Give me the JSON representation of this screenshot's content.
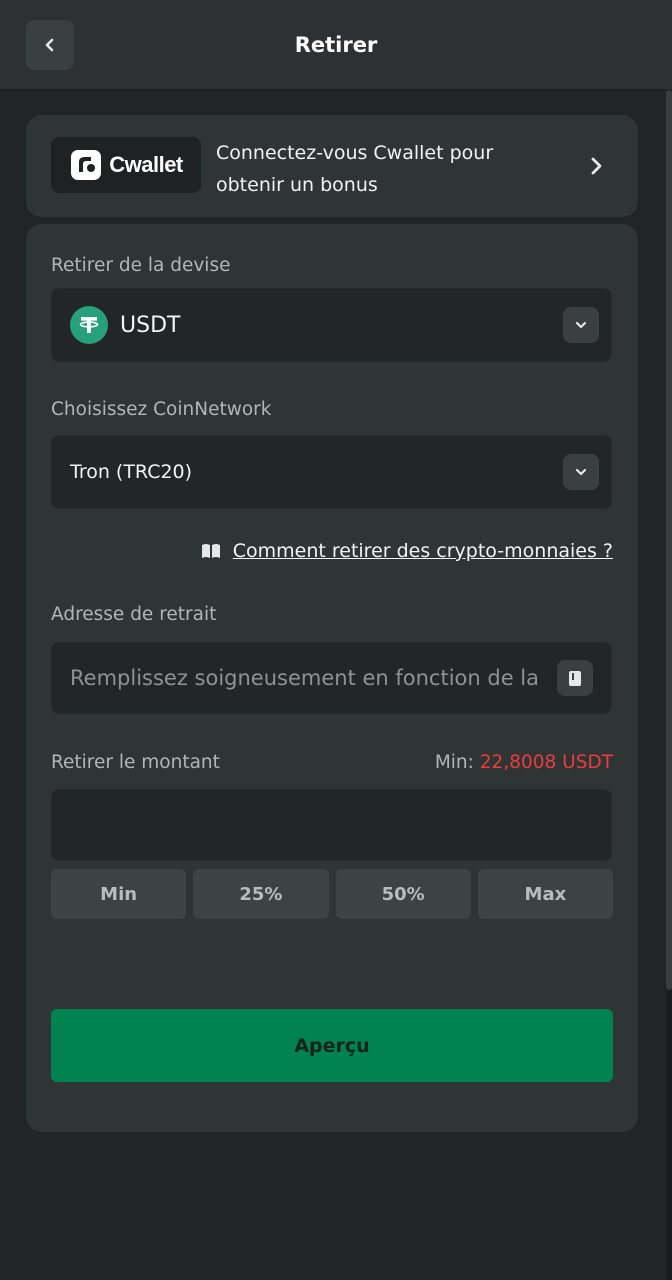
{
  "header": {
    "title": "Retirer"
  },
  "promo": {
    "logo_text": "Cwallet",
    "text": "Connectez-vous Cwallet pour obtenir un bonus"
  },
  "currency": {
    "label": "Retirer de la devise",
    "value": "USDT"
  },
  "network": {
    "label": "Choisissez CoinNetwork",
    "value": "Tron (TRC20)"
  },
  "help": {
    "link": "Comment retirer des crypto-monnaies ?"
  },
  "address": {
    "label": "Adresse de retrait",
    "placeholder": "Remplissez soigneusement en fonction de la devise"
  },
  "amount": {
    "label": "Retirer le montant",
    "min_label": "Min: ",
    "min_value": "22,8008 USDT",
    "value": ""
  },
  "quick": [
    {
      "label": "Min"
    },
    {
      "label": "25%"
    },
    {
      "label": "50%"
    },
    {
      "label": "Max"
    }
  ],
  "submit": {
    "label": "Aperçu"
  },
  "colors": {
    "background": "#222526",
    "panel": "#2f3435",
    "accent_green": "#008251",
    "tether_green": "#26a17b",
    "min_red": "#ea3d3d"
  }
}
